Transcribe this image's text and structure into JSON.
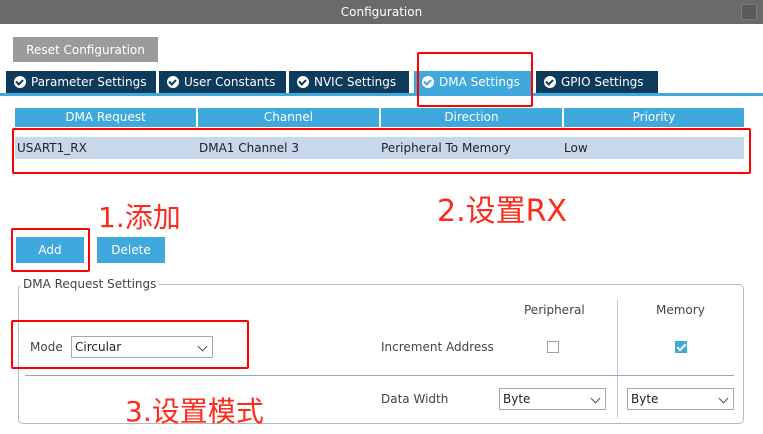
{
  "window": {
    "title": "Configuration"
  },
  "toolbar": {
    "reset_label": "Reset Configuration"
  },
  "tabs": [
    {
      "label": "Parameter Settings"
    },
    {
      "label": "User Constants"
    },
    {
      "label": "NVIC Settings"
    },
    {
      "label": "DMA Settings"
    },
    {
      "label": "GPIO Settings"
    }
  ],
  "table": {
    "headers": [
      "DMA Request",
      "Channel",
      "Direction",
      "Priority"
    ],
    "rows": [
      [
        "USART1_RX",
        "DMA1 Channel 3",
        "Peripheral To Memory",
        "Low"
      ]
    ]
  },
  "buttons": {
    "add_label": "Add",
    "delete_label": "Delete"
  },
  "annotations": {
    "step1": "1.添加",
    "step2": "2.设置RX",
    "step3": "3.设置模式"
  },
  "settings": {
    "group_title": "DMA Request Settings",
    "peripheral_header": "Peripheral",
    "memory_header": "Memory",
    "mode_label": "Mode",
    "mode_value": "Circular",
    "increment_label": "Increment Address",
    "increment_peripheral": false,
    "increment_memory": true,
    "data_width_label": "Data Width",
    "data_width_peripheral": "Byte",
    "data_width_memory": "Byte"
  },
  "colors": {
    "accent": "#3fa8dc",
    "tab_dark": "#0e3a5c",
    "annotation_red": "#ff2a1a"
  }
}
